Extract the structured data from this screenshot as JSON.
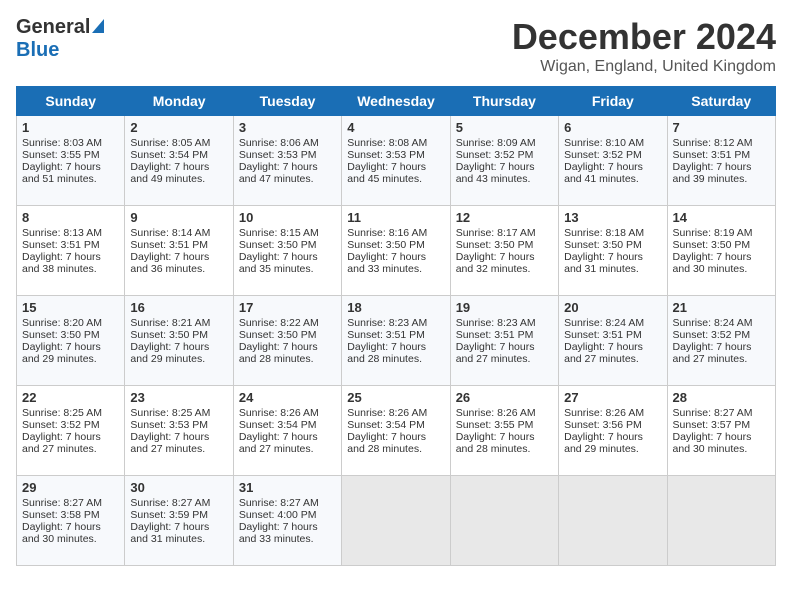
{
  "logo": {
    "general": "General",
    "blue": "Blue"
  },
  "title": {
    "month": "December 2024",
    "location": "Wigan, England, United Kingdom"
  },
  "weekdays": [
    "Sunday",
    "Monday",
    "Tuesday",
    "Wednesday",
    "Thursday",
    "Friday",
    "Saturday"
  ],
  "weeks": [
    [
      {
        "day": "1",
        "lines": [
          "Sunrise: 8:03 AM",
          "Sunset: 3:55 PM",
          "Daylight: 7 hours",
          "and 51 minutes."
        ]
      },
      {
        "day": "2",
        "lines": [
          "Sunrise: 8:05 AM",
          "Sunset: 3:54 PM",
          "Daylight: 7 hours",
          "and 49 minutes."
        ]
      },
      {
        "day": "3",
        "lines": [
          "Sunrise: 8:06 AM",
          "Sunset: 3:53 PM",
          "Daylight: 7 hours",
          "and 47 minutes."
        ]
      },
      {
        "day": "4",
        "lines": [
          "Sunrise: 8:08 AM",
          "Sunset: 3:53 PM",
          "Daylight: 7 hours",
          "and 45 minutes."
        ]
      },
      {
        "day": "5",
        "lines": [
          "Sunrise: 8:09 AM",
          "Sunset: 3:52 PM",
          "Daylight: 7 hours",
          "and 43 minutes."
        ]
      },
      {
        "day": "6",
        "lines": [
          "Sunrise: 8:10 AM",
          "Sunset: 3:52 PM",
          "Daylight: 7 hours",
          "and 41 minutes."
        ]
      },
      {
        "day": "7",
        "lines": [
          "Sunrise: 8:12 AM",
          "Sunset: 3:51 PM",
          "Daylight: 7 hours",
          "and 39 minutes."
        ]
      }
    ],
    [
      {
        "day": "8",
        "lines": [
          "Sunrise: 8:13 AM",
          "Sunset: 3:51 PM",
          "Daylight: 7 hours",
          "and 38 minutes."
        ]
      },
      {
        "day": "9",
        "lines": [
          "Sunrise: 8:14 AM",
          "Sunset: 3:51 PM",
          "Daylight: 7 hours",
          "and 36 minutes."
        ]
      },
      {
        "day": "10",
        "lines": [
          "Sunrise: 8:15 AM",
          "Sunset: 3:50 PM",
          "Daylight: 7 hours",
          "and 35 minutes."
        ]
      },
      {
        "day": "11",
        "lines": [
          "Sunrise: 8:16 AM",
          "Sunset: 3:50 PM",
          "Daylight: 7 hours",
          "and 33 minutes."
        ]
      },
      {
        "day": "12",
        "lines": [
          "Sunrise: 8:17 AM",
          "Sunset: 3:50 PM",
          "Daylight: 7 hours",
          "and 32 minutes."
        ]
      },
      {
        "day": "13",
        "lines": [
          "Sunrise: 8:18 AM",
          "Sunset: 3:50 PM",
          "Daylight: 7 hours",
          "and 31 minutes."
        ]
      },
      {
        "day": "14",
        "lines": [
          "Sunrise: 8:19 AM",
          "Sunset: 3:50 PM",
          "Daylight: 7 hours",
          "and 30 minutes."
        ]
      }
    ],
    [
      {
        "day": "15",
        "lines": [
          "Sunrise: 8:20 AM",
          "Sunset: 3:50 PM",
          "Daylight: 7 hours",
          "and 29 minutes."
        ]
      },
      {
        "day": "16",
        "lines": [
          "Sunrise: 8:21 AM",
          "Sunset: 3:50 PM",
          "Daylight: 7 hours",
          "and 29 minutes."
        ]
      },
      {
        "day": "17",
        "lines": [
          "Sunrise: 8:22 AM",
          "Sunset: 3:50 PM",
          "Daylight: 7 hours",
          "and 28 minutes."
        ]
      },
      {
        "day": "18",
        "lines": [
          "Sunrise: 8:23 AM",
          "Sunset: 3:51 PM",
          "Daylight: 7 hours",
          "and 28 minutes."
        ]
      },
      {
        "day": "19",
        "lines": [
          "Sunrise: 8:23 AM",
          "Sunset: 3:51 PM",
          "Daylight: 7 hours",
          "and 27 minutes."
        ]
      },
      {
        "day": "20",
        "lines": [
          "Sunrise: 8:24 AM",
          "Sunset: 3:51 PM",
          "Daylight: 7 hours",
          "and 27 minutes."
        ]
      },
      {
        "day": "21",
        "lines": [
          "Sunrise: 8:24 AM",
          "Sunset: 3:52 PM",
          "Daylight: 7 hours",
          "and 27 minutes."
        ]
      }
    ],
    [
      {
        "day": "22",
        "lines": [
          "Sunrise: 8:25 AM",
          "Sunset: 3:52 PM",
          "Daylight: 7 hours",
          "and 27 minutes."
        ]
      },
      {
        "day": "23",
        "lines": [
          "Sunrise: 8:25 AM",
          "Sunset: 3:53 PM",
          "Daylight: 7 hours",
          "and 27 minutes."
        ]
      },
      {
        "day": "24",
        "lines": [
          "Sunrise: 8:26 AM",
          "Sunset: 3:54 PM",
          "Daylight: 7 hours",
          "and 27 minutes."
        ]
      },
      {
        "day": "25",
        "lines": [
          "Sunrise: 8:26 AM",
          "Sunset: 3:54 PM",
          "Daylight: 7 hours",
          "and 28 minutes."
        ]
      },
      {
        "day": "26",
        "lines": [
          "Sunrise: 8:26 AM",
          "Sunset: 3:55 PM",
          "Daylight: 7 hours",
          "and 28 minutes."
        ]
      },
      {
        "day": "27",
        "lines": [
          "Sunrise: 8:26 AM",
          "Sunset: 3:56 PM",
          "Daylight: 7 hours",
          "and 29 minutes."
        ]
      },
      {
        "day": "28",
        "lines": [
          "Sunrise: 8:27 AM",
          "Sunset: 3:57 PM",
          "Daylight: 7 hours",
          "and 30 minutes."
        ]
      }
    ],
    [
      {
        "day": "29",
        "lines": [
          "Sunrise: 8:27 AM",
          "Sunset: 3:58 PM",
          "Daylight: 7 hours",
          "and 30 minutes."
        ]
      },
      {
        "day": "30",
        "lines": [
          "Sunrise: 8:27 AM",
          "Sunset: 3:59 PM",
          "Daylight: 7 hours",
          "and 31 minutes."
        ]
      },
      {
        "day": "31",
        "lines": [
          "Sunrise: 8:27 AM",
          "Sunset: 4:00 PM",
          "Daylight: 7 hours",
          "and 33 minutes."
        ]
      },
      null,
      null,
      null,
      null
    ]
  ]
}
